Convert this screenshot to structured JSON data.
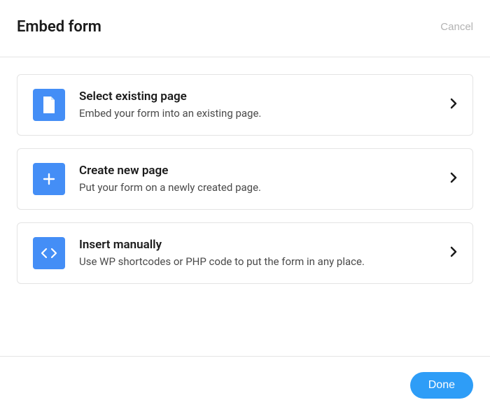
{
  "header": {
    "title": "Embed form",
    "cancel_label": "Cancel"
  },
  "options": [
    {
      "icon": "page-icon",
      "title": "Select existing page",
      "subtitle": "Embed your form into an existing page."
    },
    {
      "icon": "plus-icon",
      "title": "Create new page",
      "subtitle": "Put your form on a newly created page."
    },
    {
      "icon": "code-icon",
      "title": "Insert manually",
      "subtitle": "Use WP shortcodes or PHP code to put the form in any place."
    }
  ],
  "footer": {
    "done_label": "Done"
  },
  "colors": {
    "accent_blue": "#448ef6",
    "button_blue": "#2e9df7",
    "border": "#e4e4e4"
  }
}
